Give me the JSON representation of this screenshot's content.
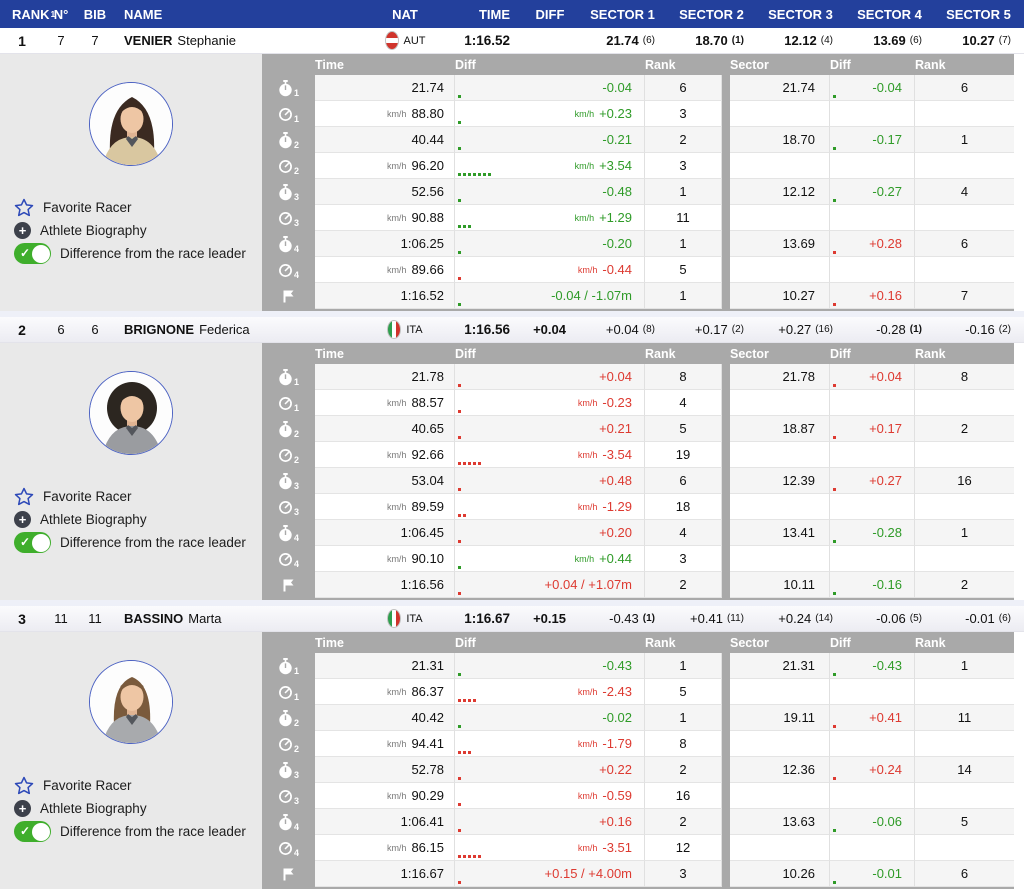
{
  "header": {
    "rank": "RANK",
    "rank_sup": "1",
    "num": "N°",
    "bib": "BIB",
    "name": "NAME",
    "nat": "NAT",
    "time": "TIME",
    "diff": "DIFF",
    "sectors": [
      "SECTOR 1",
      "SECTOR 2",
      "SECTOR 3",
      "SECTOR 4",
      "SECTOR 5"
    ]
  },
  "detail_header": {
    "time": "Time",
    "diff": "Diff",
    "rank": "Rank",
    "sector": "Sector",
    "diff2": "Diff",
    "rank2": "Rank"
  },
  "panel": {
    "favorite": "Favorite Racer",
    "biography": "Athlete Biography",
    "toggle": "Difference from the race leader"
  },
  "kmh_label": "km/h",
  "colors": {
    "header_blue": "#23409c",
    "green": "#2f9b28",
    "red": "#dd3a31",
    "table_gray": "#a9a9a9"
  },
  "racers": [
    {
      "rank": "1",
      "num": "7",
      "bib": "7",
      "last": "VENIER",
      "first": "Stephanie",
      "nat": "AUT",
      "flag": "aut",
      "time": "1:16.52",
      "diff": "",
      "avatar": {
        "hair": "#3b2a21",
        "jacket": "#d9c7a0",
        "style": "long"
      },
      "sectors": [
        {
          "v": "21.74",
          "r": "6",
          "b": false,
          "bv": true
        },
        {
          "v": "18.70",
          "r": "1",
          "b": true,
          "bv": true
        },
        {
          "v": "12.12",
          "r": "4",
          "b": false,
          "bv": true
        },
        {
          "v": "13.69",
          "r": "6",
          "b": false,
          "bv": true
        },
        {
          "v": "10.27",
          "r": "7",
          "b": false,
          "bv": true
        }
      ],
      "rows": [
        {
          "t": "timer",
          "sub": "1",
          "time": "21.74",
          "kmh": false,
          "diff": "-0.04",
          "dc": "g",
          "rank": "6",
          "sector": "21.74",
          "sdiff": "-0.04",
          "sdc": "g",
          "srank": "6",
          "dots": [
            1,
            "g"
          ],
          "sdots": [
            1,
            "g"
          ]
        },
        {
          "t": "speed",
          "sub": "1",
          "time": "88.80",
          "kmh": true,
          "diff": "+0.23",
          "dc": "g",
          "rank": "3",
          "dots": [
            1,
            "g"
          ]
        },
        {
          "t": "timer",
          "sub": "2",
          "time": "40.44",
          "kmh": false,
          "diff": "-0.21",
          "dc": "g",
          "rank": "2",
          "sector": "18.70",
          "sdiff": "-0.17",
          "sdc": "g",
          "srank": "1",
          "dots": [
            1,
            "g"
          ],
          "sdots": [
            1,
            "g"
          ]
        },
        {
          "t": "speed",
          "sub": "2",
          "time": "96.20",
          "kmh": true,
          "diff": "+3.54",
          "dc": "g",
          "rank": "3",
          "dots": [
            7,
            "g"
          ]
        },
        {
          "t": "timer",
          "sub": "3",
          "time": "52.56",
          "kmh": false,
          "diff": "-0.48",
          "dc": "g",
          "rank": "1",
          "sector": "12.12",
          "sdiff": "-0.27",
          "sdc": "g",
          "srank": "4",
          "dots": [
            1,
            "g"
          ],
          "sdots": [
            1,
            "g"
          ]
        },
        {
          "t": "speed",
          "sub": "3",
          "time": "90.88",
          "kmh": true,
          "diff": "+1.29",
          "dc": "g",
          "rank": "11",
          "dots": [
            3,
            "g"
          ]
        },
        {
          "t": "timer",
          "sub": "4",
          "time": "1:06.25",
          "kmh": false,
          "diff": "-0.20",
          "dc": "g",
          "rank": "1",
          "sector": "13.69",
          "sdiff": "+0.28",
          "sdc": "r",
          "srank": "6",
          "dots": [
            1,
            "g"
          ],
          "sdots": [
            1,
            "r"
          ]
        },
        {
          "t": "speed",
          "sub": "4",
          "time": "89.66",
          "kmh": true,
          "diff": "-0.44",
          "dc": "r",
          "rank": "5",
          "dots": [
            1,
            "r"
          ]
        },
        {
          "t": "flag",
          "sub": "",
          "time": "1:16.52",
          "kmh": false,
          "diff": "-0.04 / -1.07m",
          "dc": "g",
          "rank": "1",
          "sector": "10.27",
          "sdiff": "+0.16",
          "sdc": "r",
          "srank": "7",
          "dots": [
            1,
            "g"
          ],
          "sdots": [
            1,
            "r"
          ]
        }
      ]
    },
    {
      "rank": "2",
      "num": "6",
      "bib": "6",
      "last": "BRIGNONE",
      "first": "Federica",
      "nat": "ITA",
      "flag": "ita",
      "time": "1:16.56",
      "diff": "+0.04",
      "avatar": {
        "hair": "#2c2620",
        "jacket": "#9a9ca0",
        "style": "curly"
      },
      "sectors": [
        {
          "v": "+0.04",
          "r": "8",
          "b": false,
          "bv": false
        },
        {
          "v": "+0.17",
          "r": "2",
          "b": false,
          "bv": false
        },
        {
          "v": "+0.27",
          "r": "16",
          "b": false,
          "bv": false
        },
        {
          "v": "-0.28",
          "r": "1",
          "b": true,
          "bv": false
        },
        {
          "v": "-0.16",
          "r": "2",
          "b": false,
          "bv": false
        }
      ],
      "rows": [
        {
          "t": "timer",
          "sub": "1",
          "time": "21.78",
          "kmh": false,
          "diff": "+0.04",
          "dc": "r",
          "rank": "8",
          "sector": "21.78",
          "sdiff": "+0.04",
          "sdc": "r",
          "srank": "8",
          "dots": [
            1,
            "r"
          ],
          "sdots": [
            1,
            "r"
          ]
        },
        {
          "t": "speed",
          "sub": "1",
          "time": "88.57",
          "kmh": true,
          "diff": "-0.23",
          "dc": "r",
          "rank": "4",
          "dots": [
            1,
            "r"
          ]
        },
        {
          "t": "timer",
          "sub": "2",
          "time": "40.65",
          "kmh": false,
          "diff": "+0.21",
          "dc": "r",
          "rank": "5",
          "sector": "18.87",
          "sdiff": "+0.17",
          "sdc": "r",
          "srank": "2",
          "dots": [
            1,
            "r"
          ],
          "sdots": [
            1,
            "r"
          ]
        },
        {
          "t": "speed",
          "sub": "2",
          "time": "92.66",
          "kmh": true,
          "diff": "-3.54",
          "dc": "r",
          "rank": "19",
          "dots": [
            5,
            "r"
          ]
        },
        {
          "t": "timer",
          "sub": "3",
          "time": "53.04",
          "kmh": false,
          "diff": "+0.48",
          "dc": "r",
          "rank": "6",
          "sector": "12.39",
          "sdiff": "+0.27",
          "sdc": "r",
          "srank": "16",
          "dots": [
            1,
            "r"
          ],
          "sdots": [
            1,
            "r"
          ]
        },
        {
          "t": "speed",
          "sub": "3",
          "time": "89.59",
          "kmh": true,
          "diff": "-1.29",
          "dc": "r",
          "rank": "18",
          "dots": [
            2,
            "r"
          ]
        },
        {
          "t": "timer",
          "sub": "4",
          "time": "1:06.45",
          "kmh": false,
          "diff": "+0.20",
          "dc": "r",
          "rank": "4",
          "sector": "13.41",
          "sdiff": "-0.28",
          "sdc": "g",
          "srank": "1",
          "dots": [
            1,
            "r"
          ],
          "sdots": [
            1,
            "g"
          ]
        },
        {
          "t": "speed",
          "sub": "4",
          "time": "90.10",
          "kmh": true,
          "diff": "+0.44",
          "dc": "g",
          "rank": "3",
          "dots": [
            1,
            "g"
          ]
        },
        {
          "t": "flag",
          "sub": "",
          "time": "1:16.56",
          "kmh": false,
          "diff": "+0.04 / +1.07m",
          "dc": "r",
          "rank": "2",
          "sector": "10.11",
          "sdiff": "-0.16",
          "sdc": "g",
          "srank": "2",
          "dots": [
            1,
            "r"
          ],
          "sdots": [
            1,
            "g"
          ]
        }
      ]
    },
    {
      "rank": "3",
      "num": "11",
      "bib": "11",
      "last": "BASSINO",
      "first": "Marta",
      "nat": "ITA",
      "flag": "ita",
      "time": "1:16.67",
      "diff": "+0.15",
      "avatar": {
        "hair": "#7a5a3c",
        "jacket": "#a8aaad",
        "style": "straight"
      },
      "sectors": [
        {
          "v": "-0.43",
          "r": "1",
          "b": true,
          "bv": false
        },
        {
          "v": "+0.41",
          "r": "11",
          "b": false,
          "bv": false
        },
        {
          "v": "+0.24",
          "r": "14",
          "b": false,
          "bv": false
        },
        {
          "v": "-0.06",
          "r": "5",
          "b": false,
          "bv": false
        },
        {
          "v": "-0.01",
          "r": "6",
          "b": false,
          "bv": false
        }
      ],
      "rows": [
        {
          "t": "timer",
          "sub": "1",
          "time": "21.31",
          "kmh": false,
          "diff": "-0.43",
          "dc": "g",
          "rank": "1",
          "sector": "21.31",
          "sdiff": "-0.43",
          "sdc": "g",
          "srank": "1",
          "dots": [
            1,
            "g"
          ],
          "sdots": [
            1,
            "g"
          ]
        },
        {
          "t": "speed",
          "sub": "1",
          "time": "86.37",
          "kmh": true,
          "diff": "-2.43",
          "dc": "r",
          "rank": "5",
          "dots": [
            4,
            "r"
          ]
        },
        {
          "t": "timer",
          "sub": "2",
          "time": "40.42",
          "kmh": false,
          "diff": "-0.02",
          "dc": "g",
          "rank": "1",
          "sector": "19.11",
          "sdiff": "+0.41",
          "sdc": "r",
          "srank": "11",
          "dots": [
            1,
            "g"
          ],
          "sdots": [
            1,
            "r"
          ]
        },
        {
          "t": "speed",
          "sub": "2",
          "time": "94.41",
          "kmh": true,
          "diff": "-1.79",
          "dc": "r",
          "rank": "8",
          "dots": [
            3,
            "r"
          ]
        },
        {
          "t": "timer",
          "sub": "3",
          "time": "52.78",
          "kmh": false,
          "diff": "+0.22",
          "dc": "r",
          "rank": "2",
          "sector": "12.36",
          "sdiff": "+0.24",
          "sdc": "r",
          "srank": "14",
          "dots": [
            1,
            "r"
          ],
          "sdots": [
            1,
            "r"
          ]
        },
        {
          "t": "speed",
          "sub": "3",
          "time": "90.29",
          "kmh": true,
          "diff": "-0.59",
          "dc": "r",
          "rank": "16",
          "dots": [
            1,
            "r"
          ]
        },
        {
          "t": "timer",
          "sub": "4",
          "time": "1:06.41",
          "kmh": false,
          "diff": "+0.16",
          "dc": "r",
          "rank": "2",
          "sector": "13.63",
          "sdiff": "-0.06",
          "sdc": "g",
          "srank": "5",
          "dots": [
            1,
            "r"
          ],
          "sdots": [
            1,
            "g"
          ]
        },
        {
          "t": "speed",
          "sub": "4",
          "time": "86.15",
          "kmh": true,
          "diff": "-3.51",
          "dc": "r",
          "rank": "12",
          "dots": [
            5,
            "r"
          ]
        },
        {
          "t": "flag",
          "sub": "",
          "time": "1:16.67",
          "kmh": false,
          "diff": "+0.15 / +4.00m",
          "dc": "r",
          "rank": "3",
          "sector": "10.26",
          "sdiff": "-0.01",
          "sdc": "g",
          "srank": "6",
          "dots": [
            1,
            "r"
          ],
          "sdots": [
            1,
            "g"
          ]
        }
      ]
    }
  ]
}
